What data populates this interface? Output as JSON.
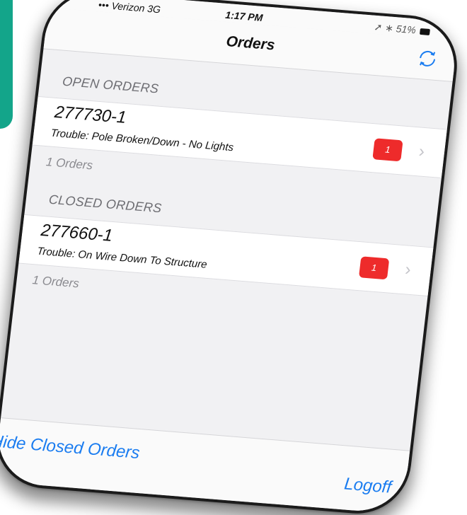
{
  "status_bar": {
    "carrier": "••• Verizon  3G",
    "time": "1:17 PM",
    "right": "➚ ∗ 51%",
    "battery_icon": "battery-icon"
  },
  "nav": {
    "title": "Orders",
    "refresh_icon": "refresh-icon",
    "accent_color": "#1a7cf0"
  },
  "open_section": {
    "header": "OPEN ORDERS",
    "orders": [
      {
        "number": "277730-1",
        "description": "Trouble: Pole Broken/Down - No Lights",
        "badge": "1"
      }
    ],
    "count": "1 Orders"
  },
  "closed_section": {
    "header": "CLOSED ORDERS",
    "orders": [
      {
        "number": "277660-1",
        "description": "Trouble: On Wire Down To Structure",
        "badge": "1"
      }
    ],
    "count": "1 Orders"
  },
  "toolbar": {
    "hide_closed": "Hide Closed Orders",
    "logoff": "Logoff"
  },
  "colors": {
    "badge": "#ee2b2b",
    "teal_card": "#13a58a"
  }
}
